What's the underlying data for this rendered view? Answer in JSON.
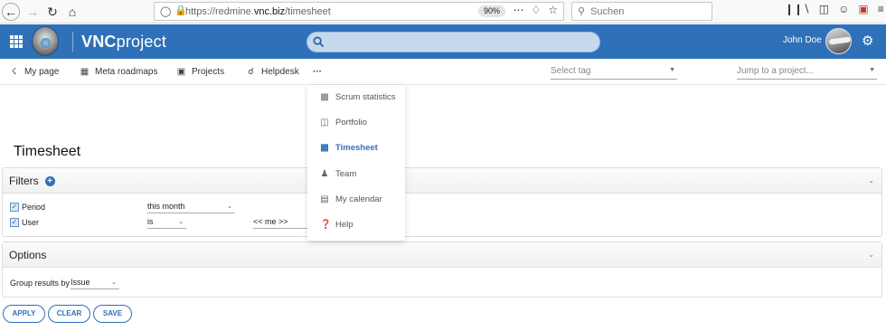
{
  "browser": {
    "url_prefix": "https://redmine.",
    "url_domain": "vnc.biz",
    "url_path": "/timesheet",
    "zoom": "90%",
    "search_placeholder": "Suchen"
  },
  "header": {
    "brand_bold": "VNC",
    "brand_rest": "project",
    "user_name": "John Doe"
  },
  "menu": {
    "items": [
      {
        "label": "My page",
        "icon": "pin-icon"
      },
      {
        "label": "Meta roadmaps",
        "icon": "map-icon"
      },
      {
        "label": "Projects",
        "icon": "briefcase-icon"
      },
      {
        "label": "Helpdesk",
        "icon": "headset-icon"
      }
    ],
    "more": "···",
    "select_tag": "Select tag",
    "jump_to": "Jump to a project..."
  },
  "dropdown": {
    "items": [
      {
        "label": "Scrum statistics",
        "icon": "bar-chart-icon",
        "active": false
      },
      {
        "label": "Portfolio",
        "icon": "folder-open-icon",
        "active": false
      },
      {
        "label": "Timesheet",
        "icon": "timesheet-icon",
        "active": true
      },
      {
        "label": "Team",
        "icon": "people-icon",
        "active": false
      },
      {
        "label": "My calendar",
        "icon": "calendar-icon",
        "active": false
      },
      {
        "label": "Help",
        "icon": "help-icon",
        "active": false
      }
    ]
  },
  "page": {
    "title": "Timesheet"
  },
  "filters": {
    "title": "Filters",
    "period_label": "Period",
    "period_value": "this month",
    "user_label": "User",
    "user_operator": "is",
    "user_value": "<< me >>"
  },
  "options": {
    "title": "Options",
    "group_label": "Group results by",
    "group_value": "Issue"
  },
  "buttons": {
    "apply": "APPLY",
    "clear": "CLEAR",
    "save": "SAVE"
  },
  "colors": {
    "brand_blue": "#2f71b8"
  }
}
